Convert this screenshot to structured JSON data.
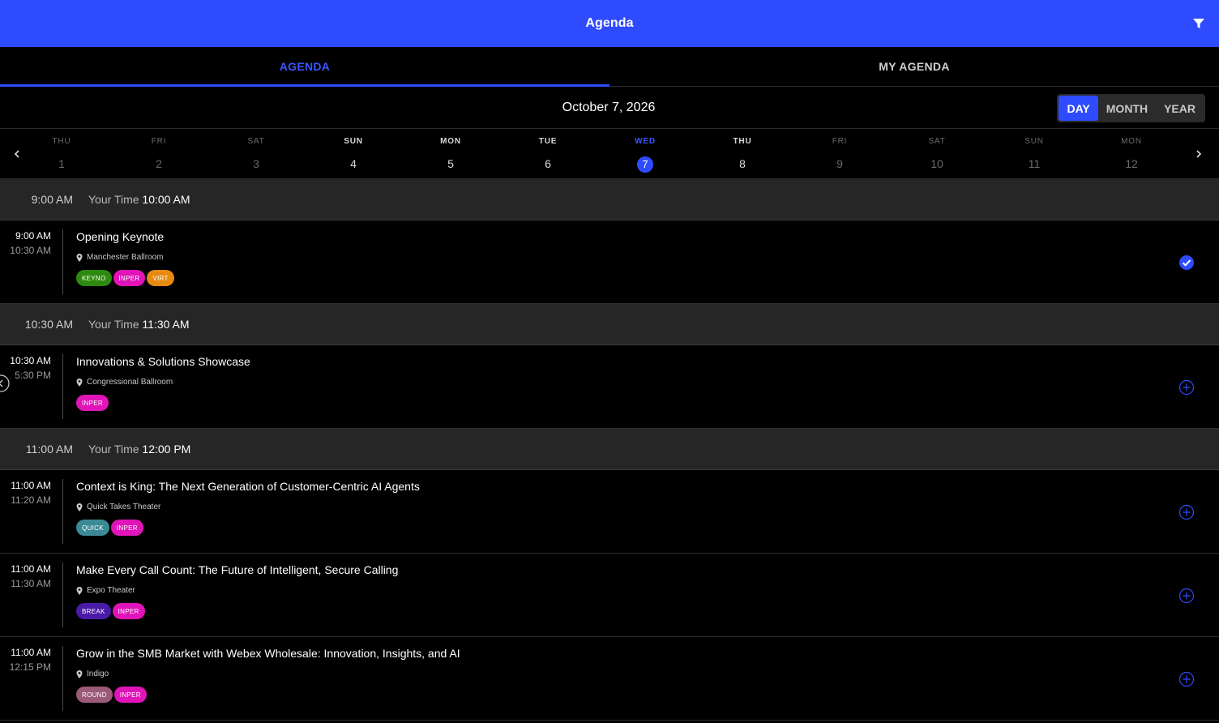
{
  "appbar": {
    "title": "Agenda",
    "filter_icon": "filter-icon",
    "color": "#2f4bff"
  },
  "tabs": [
    {
      "label": "AGENDA",
      "active": true
    },
    {
      "label": "MY AGENDA",
      "active": false
    }
  ],
  "date_title": "October 7, 2026",
  "views": [
    {
      "label": "DAY",
      "active": true
    },
    {
      "label": "MONTH",
      "active": false
    },
    {
      "label": "YEAR",
      "active": false
    }
  ],
  "days": [
    {
      "dow": "THU",
      "num": "1",
      "state": "dim"
    },
    {
      "dow": "FRI",
      "num": "2",
      "state": "dim"
    },
    {
      "dow": "SAT",
      "num": "3",
      "state": "dim"
    },
    {
      "dow": "SUN",
      "num": "4",
      "state": "norm"
    },
    {
      "dow": "MON",
      "num": "5",
      "state": "norm"
    },
    {
      "dow": "TUE",
      "num": "6",
      "state": "norm"
    },
    {
      "dow": "WED",
      "num": "7",
      "state": "sel"
    },
    {
      "dow": "THU",
      "num": "8",
      "state": "norm"
    },
    {
      "dow": "FRI",
      "num": "9",
      "state": "dim"
    },
    {
      "dow": "SAT",
      "num": "10",
      "state": "dim"
    },
    {
      "dow": "SUN",
      "num": "11",
      "state": "dim"
    },
    {
      "dow": "MON",
      "num": "12",
      "state": "dim"
    }
  ],
  "slots": [
    {
      "time": "9:00 AM",
      "your_time_label": "Your Time",
      "your_time": "10:00 AM",
      "sessions": [
        {
          "start": "9:00 AM",
          "end": "10:30 AM",
          "title": "Opening Keynote",
          "location": "Manchester Ballroom",
          "tags": [
            {
              "label": "KEYNO",
              "color": "#2e8a0f"
            },
            {
              "label": "INPER",
              "color": "#e014b8"
            },
            {
              "label": "VIRT",
              "color": "#e88a10"
            }
          ],
          "added": true
        }
      ]
    },
    {
      "time": "10:30 AM",
      "your_time_label": "Your Time",
      "your_time": "11:30 AM",
      "sessions": [
        {
          "start": "10:30 AM",
          "end": "5:30 PM",
          "title": "Innovations & Solutions Showcase",
          "location": "Congressional Ballroom",
          "tags": [
            {
              "label": "INPER",
              "color": "#e014b8"
            }
          ],
          "added": false,
          "collapse_handle": true
        }
      ]
    },
    {
      "time": "11:00 AM",
      "your_time_label": "Your Time",
      "your_time": "12:00 PM",
      "sessions": [
        {
          "start": "11:00 AM",
          "end": "11:20 AM",
          "title": "Context is King: The Next Generation of Customer-Centric AI Agents",
          "location": "Quick Takes Theater",
          "tags": [
            {
              "label": "QUICK",
              "color": "#3a8a96"
            },
            {
              "label": "INPER",
              "color": "#e014b8"
            }
          ],
          "added": false
        },
        {
          "start": "11:00 AM",
          "end": "11:30 AM",
          "title": "Make Every Call Count: The Future of Intelligent, Secure Calling",
          "location": "Expo Theater",
          "tags": [
            {
              "label": "BREAK",
              "color": "#4a1aa8"
            },
            {
              "label": "INPER",
              "color": "#e014b8"
            }
          ],
          "added": false
        },
        {
          "start": "11:00 AM",
          "end": "12:15 PM",
          "title": "Grow in the SMB Market with Webex Wholesale: Innovation, Insights, and AI",
          "location": "Indigo",
          "tags": [
            {
              "label": "ROUND",
              "color": "#9a5a78"
            },
            {
              "label": "INPER",
              "color": "#e014b8"
            }
          ],
          "added": false
        }
      ]
    }
  ]
}
